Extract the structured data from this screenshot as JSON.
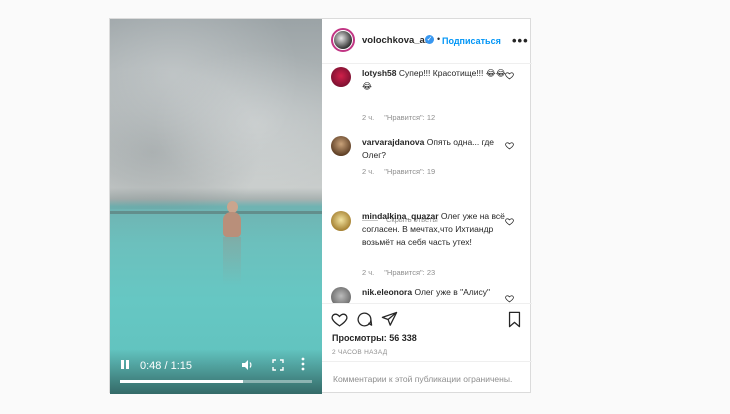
{
  "header": {
    "username": "volochkova_art",
    "verified_icon": "verified-badge-icon",
    "separator": "•",
    "follow_label": "Подписаться",
    "more_label": "•••"
  },
  "video": {
    "current_time": "0:48",
    "time_separator": " / ",
    "duration": "1:15",
    "progress_fraction": 0.64
  },
  "comments": [
    {
      "username": "lotysh58",
      "text": "Супер!!! Красотище!!! 😂😂😂",
      "time": "2 ч.",
      "likes": "\"Нравится\": 12"
    },
    {
      "username": "varvarajdanova",
      "text": "Опять одна... где Олег?",
      "time": "2 ч.",
      "likes": "\"Нравится\": 19"
    },
    {
      "username": "mindalkina_quazar",
      "text": "Олег уже на всё согласен. В мечтах,что Ихтиандр возьмёт на себя часть утех!",
      "time": "2 ч.",
      "likes": "\"Нравится\": 23"
    },
    {
      "username": "nik.eleonora",
      "text": "Олег уже в \"Алису\" превратился",
      "time": "",
      "likes": ""
    }
  ],
  "hide_replies_label": "Скрыть ответы",
  "views": "Просмотры: 56 338",
  "posted_ago": "2 ЧАСОВ НАЗАД",
  "comments_limited": "Комментарии к этой публикации ограничены.",
  "colors": {
    "follow": "#0095f6",
    "verified": "#3897f0",
    "muted": "#8e8e8e"
  }
}
